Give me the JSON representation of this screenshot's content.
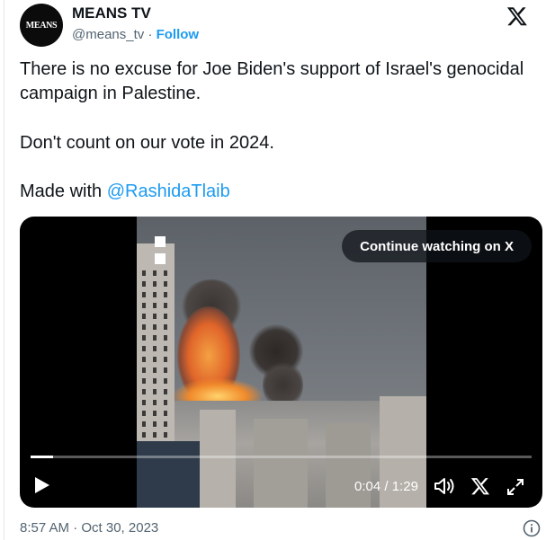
{
  "author": {
    "avatar_text": "MEANS",
    "display_name": "MEANS TV",
    "handle": "@means_tv",
    "separator": "·",
    "follow_label": "Follow"
  },
  "tweet": {
    "paragraph_1": "There is no excuse for Joe Biden's support of Israel's genocidal campaign in Palestine.",
    "paragraph_2": "Don't count on our vote in 2024.",
    "paragraph_3_prefix": "Made with ",
    "mention": "@RashidaTlaib"
  },
  "video": {
    "continue_label": "Continue watching on X",
    "time_current": "0:04",
    "time_separator": " / ",
    "time_total": "1:29",
    "progress": 0.045
  },
  "footer": {
    "timestamp": "8:57 AM · Oct 30, 2023"
  },
  "icons": {
    "x_logo": "x-logo-icon",
    "play": "play-icon",
    "volume": "volume-icon",
    "expand": "expand-icon",
    "info": "info-icon"
  },
  "colors": {
    "accent": "#1d9bf0",
    "text": "#0f1419",
    "muted": "#536471"
  }
}
